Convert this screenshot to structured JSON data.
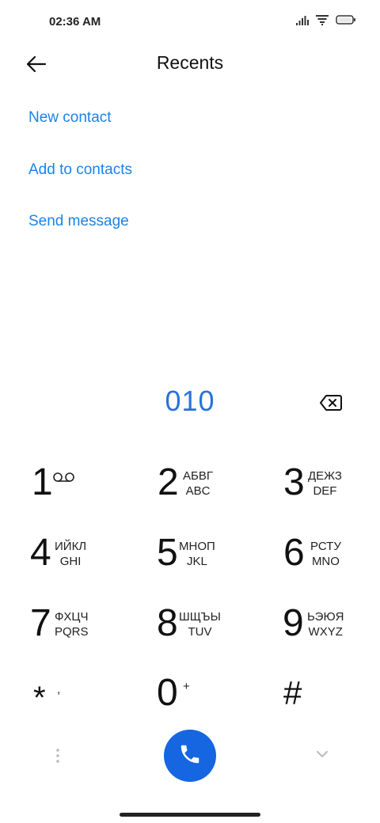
{
  "status_bar": {
    "time": "02:36 AM",
    "icons": [
      "signal-icon",
      "wifi-icon",
      "battery-icon"
    ]
  },
  "header": {
    "title": "Recents",
    "back_icon": "arrow-left-icon"
  },
  "actions": [
    {
      "label": "New contact"
    },
    {
      "label": "Add to contacts"
    },
    {
      "label": "Send message"
    }
  ],
  "dialer": {
    "number": "010",
    "backspace_icon": "backspace-icon"
  },
  "keypad": [
    {
      "digit": "1",
      "sub1": "",
      "sub2": "",
      "icon": "voicemail-icon"
    },
    {
      "digit": "2",
      "sub1": "АБВГ",
      "sub2": "ABC"
    },
    {
      "digit": "3",
      "sub1": "ДЕЖЗ",
      "sub2": "DEF"
    },
    {
      "digit": "4",
      "sub1": "ИЙКЛ",
      "sub2": "GHI"
    },
    {
      "digit": "5",
      "sub1": "МНОП",
      "sub2": "JKL"
    },
    {
      "digit": "6",
      "sub1": "РСТУ",
      "sub2": "MNO"
    },
    {
      "digit": "7",
      "sub1": "ФХЦЧ",
      "sub2": "PQRS"
    },
    {
      "digit": "8",
      "sub1": "ШЩЪЫ",
      "sub2": "TUV"
    },
    {
      "digit": "9",
      "sub1": "ЬЭЮЯ",
      "sub2": "WXYZ"
    },
    {
      "digit": "*",
      "sub1": ",",
      "sub2": ""
    },
    {
      "digit": "0",
      "sub1": "+",
      "sub2": ""
    },
    {
      "digit": "#",
      "sub1": "",
      "sub2": ""
    }
  ],
  "bottom_bar": {
    "menu_icon": "more-vertical-icon",
    "call_icon": "phone-icon",
    "collapse_icon": "chevron-down-icon",
    "call_color": "#1566e0"
  },
  "colors": {
    "accent": "#1a83e6",
    "number": "#2a72d8"
  }
}
